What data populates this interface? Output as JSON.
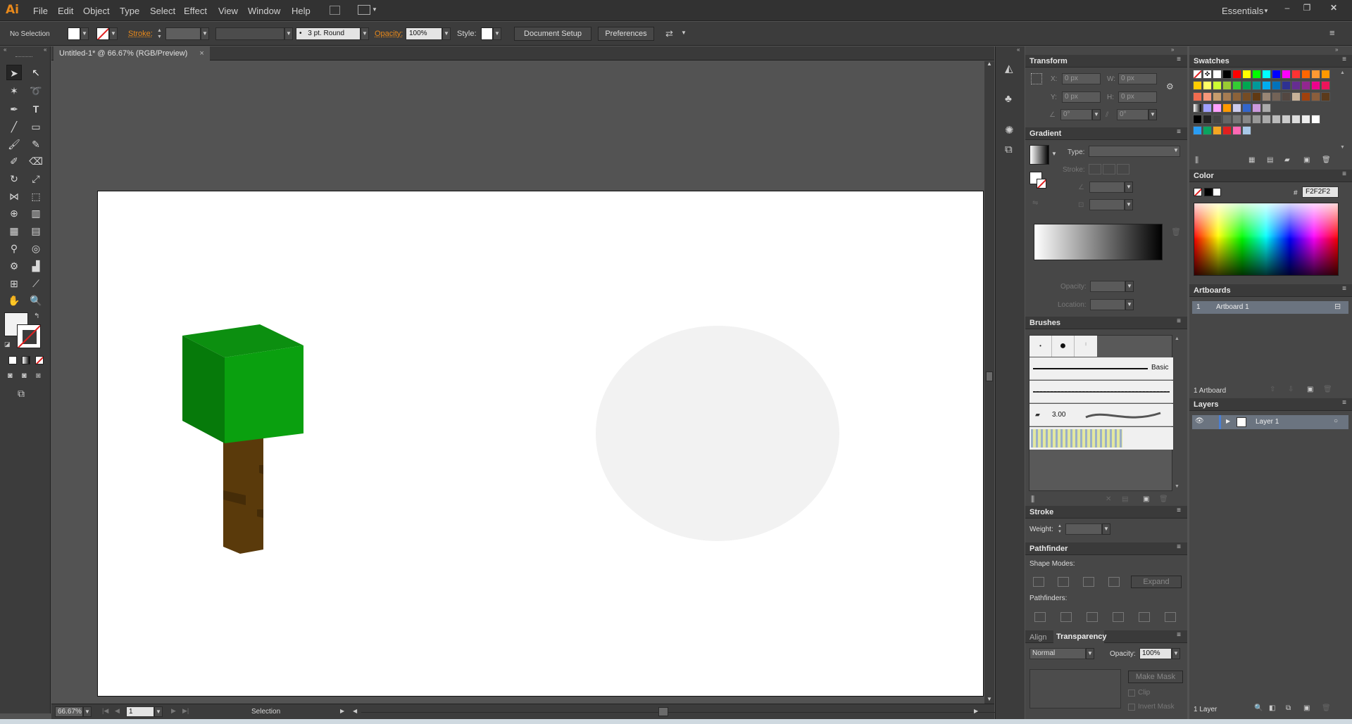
{
  "app": {
    "logo": "Ai",
    "menus": [
      "File",
      "Edit",
      "Object",
      "Type",
      "Select",
      "Effect",
      "View",
      "Window",
      "Help"
    ],
    "workspace": "Essentials"
  },
  "control_bar": {
    "selection": "No Selection",
    "stroke_label": "Stroke:",
    "brush": "3 pt. Round",
    "brush_bullet": "•",
    "opacity_label": "Opacity:",
    "opacity_value": "100%",
    "style_label": "Style:",
    "document_setup": "Document Setup",
    "preferences": "Preferences"
  },
  "document": {
    "tab_title": "Untitled-1* @ 66.67% (RGB/Preview)",
    "close": "×"
  },
  "status_bar": {
    "zoom": "66.67%",
    "artboard_number": "1",
    "tool_name": "Selection"
  },
  "transform": {
    "title": "Transform",
    "x_label": "X:",
    "x": "0 px",
    "y_label": "Y:",
    "y": "0 px",
    "w_label": "W:",
    "w": "0 px",
    "h_label": "H:",
    "h": "0 px",
    "angle": "0°",
    "shear": "0°"
  },
  "gradient": {
    "title": "Gradient",
    "type_label": "Type:",
    "stroke_label": "Stroke:",
    "opacity_label": "Opacity:",
    "location_label": "Location:"
  },
  "brushes": {
    "title": "Brushes",
    "basic_label": "Basic",
    "size_label": "3.00"
  },
  "stroke": {
    "title": "Stroke",
    "weight_label": "Weight:"
  },
  "pathfinder": {
    "title": "Pathfinder",
    "shape_modes": "Shape Modes:",
    "expand": "Expand",
    "pathfinders": "Pathfinders:"
  },
  "transparency": {
    "tab_align": "Align",
    "tab_transparency": "Transparency",
    "blend_mode": "Normal",
    "opacity_label": "Opacity:",
    "opacity_value": "100%",
    "make_mask": "Make Mask",
    "clip": "Clip",
    "invert_mask": "Invert Mask"
  },
  "swatches": {
    "title": "Swatches"
  },
  "color": {
    "title": "Color",
    "hash": "#",
    "hex": "F2F2F2"
  },
  "artboards": {
    "title": "Artboards",
    "rows": [
      {
        "index": "1",
        "name": "Artboard 1"
      }
    ],
    "count": "1 Artboard"
  },
  "layers": {
    "title": "Layers",
    "rows": [
      {
        "name": "Layer 1"
      }
    ],
    "count": "1 Layer"
  },
  "colors": {
    "accent_orange": "#e8891b",
    "tree_leaf_front": "#0aa00f",
    "tree_leaf_side": "#067a0a",
    "tree_leaf_top": "#0c8f10",
    "tree_trunk": "#5a3a0b",
    "ellipse_fill": "#f2f2f2"
  }
}
